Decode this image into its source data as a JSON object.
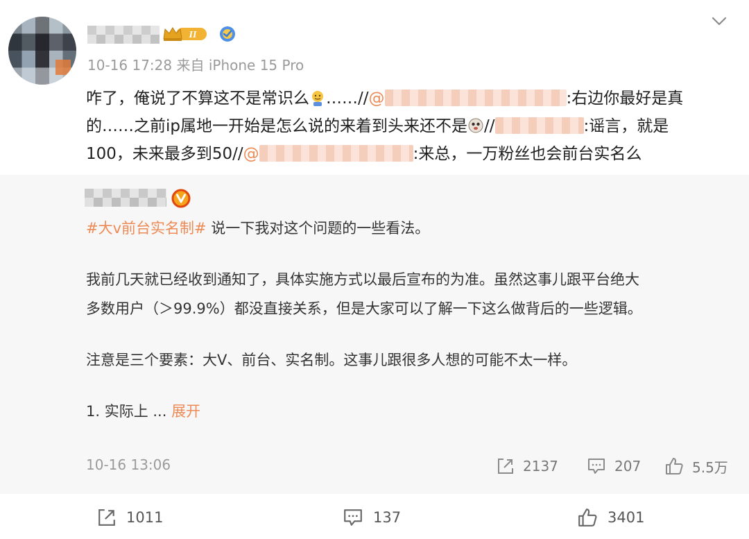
{
  "post": {
    "meta": "10-16 17:28  来自 iPhone 15 Pro",
    "vip_level": "II",
    "repost_lines": [
      {
        "before": "咋了，俺说了不算这不是常识么",
        "mid": "……//",
        "after": ":右边你最好是真"
      },
      {
        "before": "的……之前ip属地一开始是怎么说的来着到头来还不是",
        "mid": "//",
        "after": ":谣言，就是"
      },
      {
        "before": "100，未来最多到50//",
        "mid": "",
        "after": ":来总，一万粉丝也会前台实名么"
      }
    ]
  },
  "original": {
    "hashtag": "#大v前台实名制#",
    "intro": " 说一下我对这个问题的一些看法。",
    "para1_line1": "我前几天就已经收到通知了，具体实施方式以最后宣布的为准。虽然这事儿跟平台绝大",
    "para1_line2": "多数用户（＞99.9%）都没直接关系，但是大家可以了解一下这么做背后的一些逻辑。",
    "para2": "注意是三个要素：大V、前台、实名制。这事儿跟很多人想的可能不太一样。",
    "para3": "1. 实际上 ... ",
    "expand": "展开",
    "time": "10-16 13:06",
    "reposts": "2137",
    "comments": "207",
    "likes": "5.5万"
  },
  "bottom": {
    "reposts": "1011",
    "comments": "137",
    "likes": "3401"
  },
  "colors": {
    "accent": "#ee8a55",
    "gold": "#f2b233",
    "card_bg": "#f7f7f7",
    "meta_gray": "#9a9a9a"
  },
  "icons": [
    "chevron-down-icon",
    "vip-crown-icon",
    "verified-icon",
    "orange-v-icon",
    "repost-icon",
    "comment-icon",
    "like-icon",
    "emoji-shrug-icon",
    "emoji-doge-icon"
  ]
}
